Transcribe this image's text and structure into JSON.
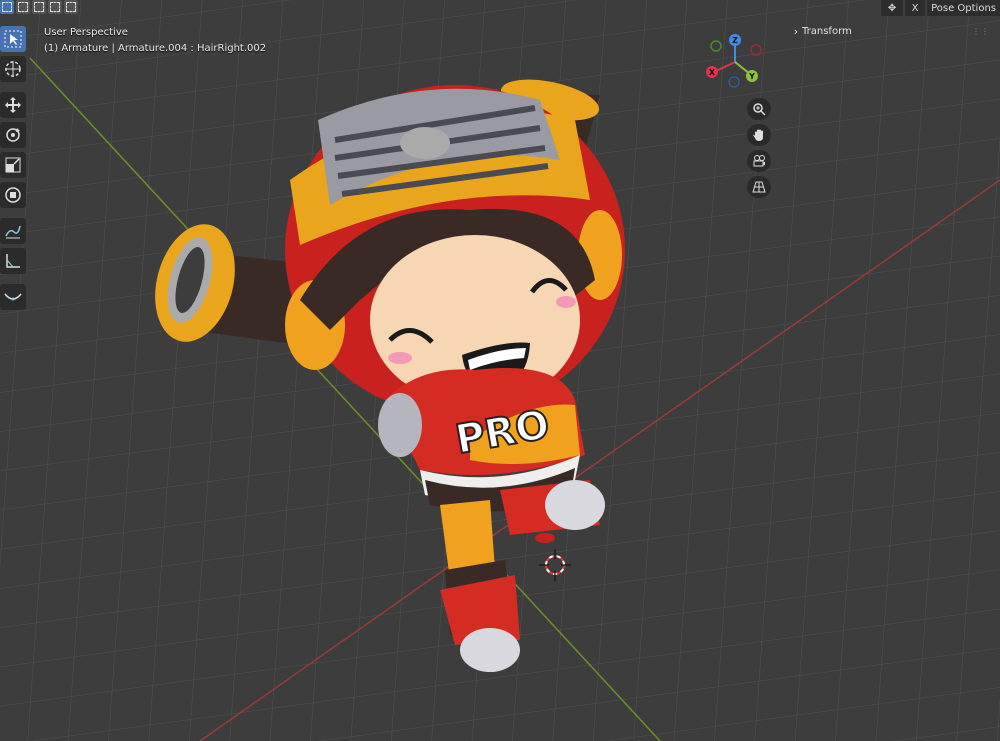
{
  "header": {
    "pose_options_label": "Pose Options",
    "close_label": "X"
  },
  "view": {
    "perspective": "User Perspective",
    "active": "(1) Armature | Armature.004 : HairRight.002"
  },
  "npanel": {
    "transform_label": "Transform"
  },
  "gizmo": {
    "z_label": "Z",
    "x_label": "X",
    "y_label": "Y",
    "x_color": "#e2334d",
    "y_color": "#8bc437",
    "z_color": "#3d8ee8"
  },
  "tools": [
    "select-box",
    "cursor",
    "move",
    "rotate",
    "scale",
    "transform",
    "annotate",
    "measure",
    "bone"
  ],
  "character_text": "PRO"
}
